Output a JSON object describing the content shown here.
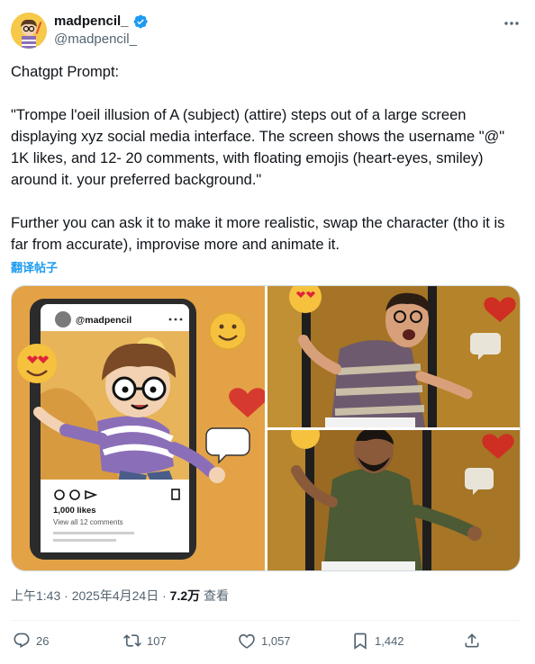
{
  "author": {
    "display_name": "madpencil_",
    "handle": "@madpencil_",
    "verified": true
  },
  "tweet": {
    "paragraph_1": "Chatgpt Prompt:",
    "paragraph_2": "\"Trompe l'oeil illusion of A (subject) (attire) steps out of a large screen displaying xyz social media interface. The screen shows the username \"@\" 1K likes, and 12- 20 comments, with floating emojis (heart-eyes, smiley) around it. your preferred background.\"",
    "paragraph_3": "Further you can ask it to make it more realistic, swap the character (tho it is far from accurate), improvise more and animate it.",
    "translate_label": "翻译帖子"
  },
  "media": {
    "left_image": {
      "username": "@madpencil",
      "likes": "1,000 likes",
      "comments": "View all 12 comments"
    }
  },
  "meta": {
    "time": "上午1:43",
    "date": "2025年4月24日",
    "views_count": "7.2万",
    "views_label": "查看",
    "separator": "·"
  },
  "actions": {
    "replies": "26",
    "reposts": "107",
    "likes": "1,057",
    "bookmarks": "1,442"
  },
  "colors": {
    "accent": "#1d9bf0",
    "secondary_text": "#536471",
    "verified_badge": "#1d9bf0"
  }
}
